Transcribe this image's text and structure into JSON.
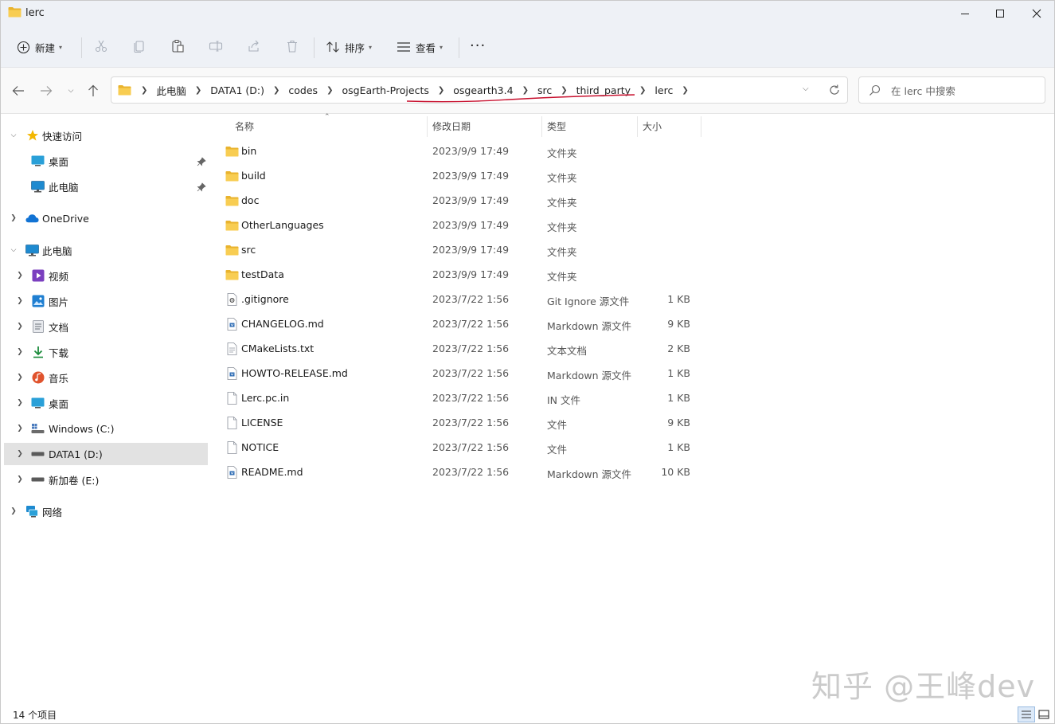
{
  "window": {
    "title": "lerc"
  },
  "toolbar": {
    "new_label": "新建",
    "sort_label": "排序",
    "view_label": "查看",
    "more_label": "···"
  },
  "address": {
    "crumbs": [
      "此电脑",
      "DATA1 (D:)",
      "codes",
      "osgEarth-Projects",
      "osgearth3.4",
      "src",
      "third_party",
      "lerc"
    ]
  },
  "search": {
    "placeholder": "在 lerc 中搜索"
  },
  "sidebar": {
    "items": [
      {
        "label": "快速访问"
      },
      {
        "label": "桌面"
      },
      {
        "label": "此电脑"
      },
      {
        "label": "OneDrive"
      },
      {
        "label": "此电脑"
      },
      {
        "label": "视频"
      },
      {
        "label": "图片"
      },
      {
        "label": "文档"
      },
      {
        "label": "下载"
      },
      {
        "label": "音乐"
      },
      {
        "label": "桌面"
      },
      {
        "label": "Windows (C:)"
      },
      {
        "label": "DATA1 (D:)"
      },
      {
        "label": "新加卷 (E:)"
      },
      {
        "label": "网络"
      }
    ]
  },
  "columns": {
    "name": "名称",
    "date": "修改日期",
    "type": "类型",
    "size": "大小"
  },
  "files": [
    {
      "name": "bin",
      "date": "2023/9/9 17:49",
      "type": "文件夹",
      "size": ""
    },
    {
      "name": "build",
      "date": "2023/9/9 17:49",
      "type": "文件夹",
      "size": ""
    },
    {
      "name": "doc",
      "date": "2023/9/9 17:49",
      "type": "文件夹",
      "size": ""
    },
    {
      "name": "OtherLanguages",
      "date": "2023/9/9 17:49",
      "type": "文件夹",
      "size": ""
    },
    {
      "name": "src",
      "date": "2023/9/9 17:49",
      "type": "文件夹",
      "size": ""
    },
    {
      "name": "testData",
      "date": "2023/9/9 17:49",
      "type": "文件夹",
      "size": ""
    },
    {
      "name": ".gitignore",
      "date": "2023/7/22 1:56",
      "type": "Git Ignore 源文件",
      "size": "1 KB"
    },
    {
      "name": "CHANGELOG.md",
      "date": "2023/7/22 1:56",
      "type": "Markdown 源文件",
      "size": "9 KB"
    },
    {
      "name": "CMakeLists.txt",
      "date": "2023/7/22 1:56",
      "type": "文本文档",
      "size": "2 KB"
    },
    {
      "name": "HOWTO-RELEASE.md",
      "date": "2023/7/22 1:56",
      "type": "Markdown 源文件",
      "size": "1 KB"
    },
    {
      "name": "Lerc.pc.in",
      "date": "2023/7/22 1:56",
      "type": "IN 文件",
      "size": "1 KB"
    },
    {
      "name": "LICENSE",
      "date": "2023/7/22 1:56",
      "type": "文件",
      "size": "9 KB"
    },
    {
      "name": "NOTICE",
      "date": "2023/7/22 1:56",
      "type": "文件",
      "size": "1 KB"
    },
    {
      "name": "README.md",
      "date": "2023/7/22 1:56",
      "type": "Markdown 源文件",
      "size": "10 KB"
    }
  ],
  "status": {
    "count": "14 个项目"
  },
  "watermark": "知乎 @王峰dev",
  "colors": {
    "folder": "#f6c342",
    "accent": "#0067c0",
    "annotation": "#c8102e"
  }
}
